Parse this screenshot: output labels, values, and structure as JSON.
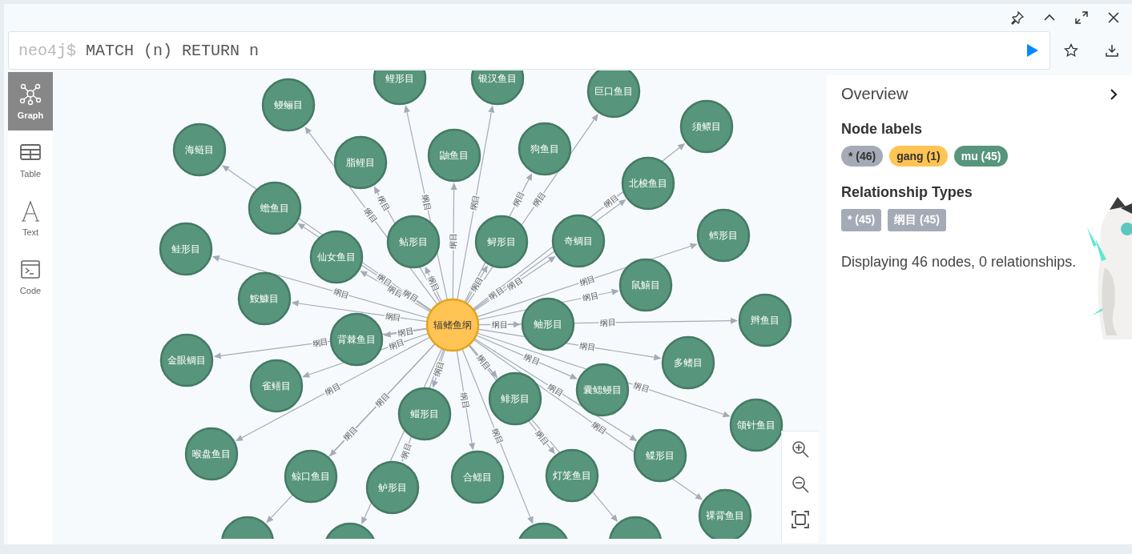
{
  "editor": {
    "prompt": "neo4j$",
    "query": "MATCH (n) RETURN n"
  },
  "view_tabs": [
    {
      "label": "Graph",
      "selected": true
    },
    {
      "label": "Table",
      "selected": false
    },
    {
      "label": "Text",
      "selected": false
    },
    {
      "label": "Code",
      "selected": false
    }
  ],
  "graph": {
    "center": {
      "label": "辐鳍鱼纲",
      "kind": "gang"
    },
    "nodes": [
      {
        "label": "鲤形目",
        "kind": "mu",
        "rel": "纲目"
      },
      {
        "label": "银汉鱼目",
        "kind": "mu",
        "rel": "纲目"
      },
      {
        "label": "巨口鱼目",
        "kind": "mu",
        "rel": "纲目"
      },
      {
        "label": "鳗鲡目",
        "kind": "mu",
        "rel": "纲目"
      },
      {
        "label": "须鳂目",
        "kind": "mu",
        "rel": "纲目"
      },
      {
        "label": "海鲢目",
        "kind": "mu",
        "rel": "纲目"
      },
      {
        "label": "狗鱼目",
        "kind": "mu",
        "rel": "纲目"
      },
      {
        "label": "鼬鱼目",
        "kind": "mu",
        "rel": "纲目"
      },
      {
        "label": "脂鲤目",
        "kind": "mu",
        "rel": "纲目"
      },
      {
        "label": "北梭鱼目",
        "kind": "mu",
        "rel": "纲目"
      },
      {
        "label": "蟾鱼目",
        "kind": "mu",
        "rel": "纲目"
      },
      {
        "label": "鳕形目",
        "kind": "mu",
        "rel": "纲目"
      },
      {
        "label": "鲇形目",
        "kind": "mu",
        "rel": "纲目"
      },
      {
        "label": "鲟形目",
        "kind": "mu",
        "rel": "纲目"
      },
      {
        "label": "奇鲷目",
        "kind": "mu",
        "rel": "纲目"
      },
      {
        "label": "鲑形目",
        "kind": "mu",
        "rel": "纲目"
      },
      {
        "label": "仙女鱼目",
        "kind": "mu",
        "rel": "纲目"
      },
      {
        "label": "鼠鱚目",
        "kind": "mu",
        "rel": "纲目"
      },
      {
        "label": "鮟鱇目",
        "kind": "mu",
        "rel": "纲目"
      },
      {
        "label": "鲉形目",
        "kind": "mu",
        "rel": "纲目"
      },
      {
        "label": "辫鱼目",
        "kind": "mu",
        "rel": "纲目"
      },
      {
        "label": "背棘鱼目",
        "kind": "mu",
        "rel": "纲目"
      },
      {
        "label": "金眼鲷目",
        "kind": "mu",
        "rel": "纲目"
      },
      {
        "label": "多鳍目",
        "kind": "mu",
        "rel": "纲目"
      },
      {
        "label": "雀鳝目",
        "kind": "mu",
        "rel": "纲目"
      },
      {
        "label": "囊鳃鳗目",
        "kind": "mu",
        "rel": "纲目"
      },
      {
        "label": "鲱形目",
        "kind": "mu"
      },
      {
        "label": "鲻形目",
        "kind": "mu",
        "rel": "纲目"
      },
      {
        "label": "颌针鱼目",
        "kind": "mu",
        "rel": "纲目"
      },
      {
        "label": "喉盘鱼目",
        "kind": "mu",
        "rel": "纲目"
      },
      {
        "label": "鲽形目",
        "kind": "mu",
        "rel": "纲目"
      },
      {
        "label": "鲸口鱼目",
        "kind": "mu",
        "rel": "纲目"
      },
      {
        "label": "合鳃目",
        "kind": "mu",
        "rel": "纲目"
      },
      {
        "label": "灯笼鱼目",
        "kind": "mu",
        "rel": "纲目"
      },
      {
        "label": "鲈形目",
        "kind": "mu",
        "rel": "纲目"
      },
      {
        "label": "裸背鱼目",
        "kind": "mu",
        "rel": "纲目"
      },
      {
        "kind": "mu",
        "rel": "纲目"
      },
      {
        "kind": "mu",
        "rel": "纲目"
      },
      {
        "kind": "mu"
      },
      {
        "kind": "mu",
        "rel": "纲目"
      }
    ]
  },
  "overview": {
    "title": "Overview",
    "node_labels_heading": "Node labels",
    "node_labels": [
      {
        "text": "* (46)",
        "color": "#a5abb6"
      },
      {
        "text": "gang (1)",
        "color": "#ffc454"
      },
      {
        "text": "mu (45)",
        "color": "#57957d"
      }
    ],
    "relationship_types_heading": "Relationship Types",
    "relationship_types": [
      {
        "text": "* (45)"
      },
      {
        "text": "纲目 (45)"
      }
    ],
    "summary": "Displaying 46 nodes, 0 relationships."
  }
}
